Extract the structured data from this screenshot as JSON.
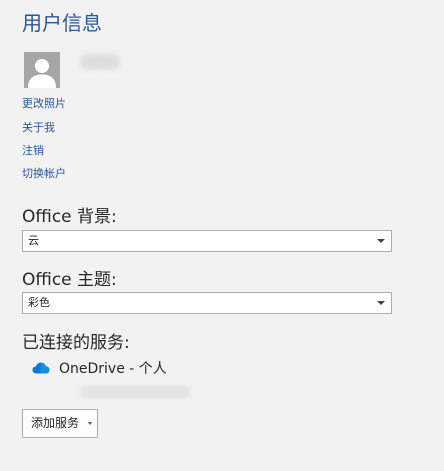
{
  "user_info": {
    "title": "用户信息",
    "avatar_icon": "person-silhouette-icon",
    "links": {
      "change_photo": "更改照片",
      "about_me": "关于我",
      "sign_out": "注销",
      "switch_account": "切换帐户"
    }
  },
  "office_background": {
    "label": "Office 背景:",
    "selected": "云"
  },
  "office_theme": {
    "label": "Office 主题:",
    "selected": "彩色"
  },
  "connected_services": {
    "label": "已连接的服务:",
    "items": [
      {
        "name": "OneDrive - 个人",
        "icon": "onedrive-cloud-icon"
      }
    ],
    "add_button_label": "添加服务"
  },
  "colors": {
    "accent": "#2b579a",
    "background": "#f2f2f2",
    "onedrive_blue": "#0f78d4"
  }
}
